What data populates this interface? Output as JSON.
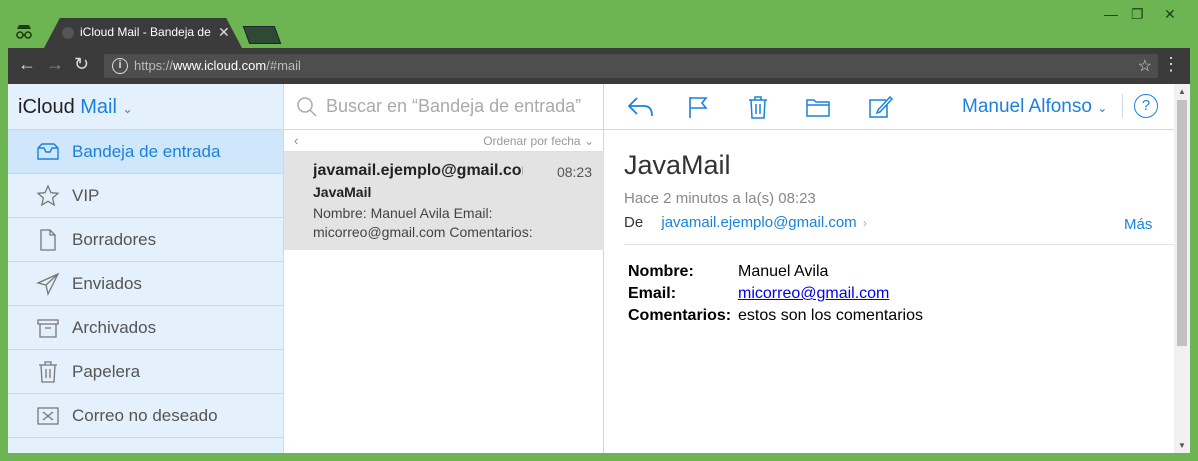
{
  "browser": {
    "tab_title": "iCloud Mail - Bandeja de entrada",
    "url_scheme": "https://",
    "url_host": "www.icloud.com",
    "url_path": "/#mail",
    "colors": {
      "frame": "#6cb552",
      "chrome": "#3b3b3b"
    }
  },
  "sidebar": {
    "brand": "iCloud",
    "app": "Mail",
    "items": [
      {
        "label": "Bandeja de entrada",
        "icon": "inbox-icon",
        "active": true
      },
      {
        "label": "VIP",
        "icon": "star-icon"
      },
      {
        "label": "Borradores",
        "icon": "document-icon"
      },
      {
        "label": "Enviados",
        "icon": "paper-plane-icon"
      },
      {
        "label": "Archivados",
        "icon": "archive-box-icon"
      },
      {
        "label": "Papelera",
        "icon": "trash-icon"
      },
      {
        "label": "Correo no deseado",
        "icon": "junk-box-icon"
      }
    ]
  },
  "list": {
    "search_placeholder": "Buscar en “Bandeja de entrada”",
    "sort_label": "Ordenar por fecha",
    "messages": [
      {
        "from": "javamail.ejemplo@gmail.com",
        "time": "08:23",
        "subject": "JavaMail",
        "preview": "Nombre: Manuel Avila Email: micorreo@gmail.com Comentarios:"
      }
    ]
  },
  "reader": {
    "user_name": "Manuel Alfonso",
    "help": "?",
    "subject": "JavaMail",
    "date": "Hace 2 minutos a la(s) 08:23",
    "from_label": "De",
    "from_address": "javamail.ejemplo@gmail.com",
    "more_label": "Más",
    "body": [
      {
        "key": "Nombre:",
        "value": "Manuel Avila"
      },
      {
        "key": "Email:",
        "value": "micorreo@gmail.com"
      },
      {
        "key": "Comentarios:",
        "value": "estos son los comentarios"
      }
    ],
    "accent_color": "#1a82dc"
  }
}
